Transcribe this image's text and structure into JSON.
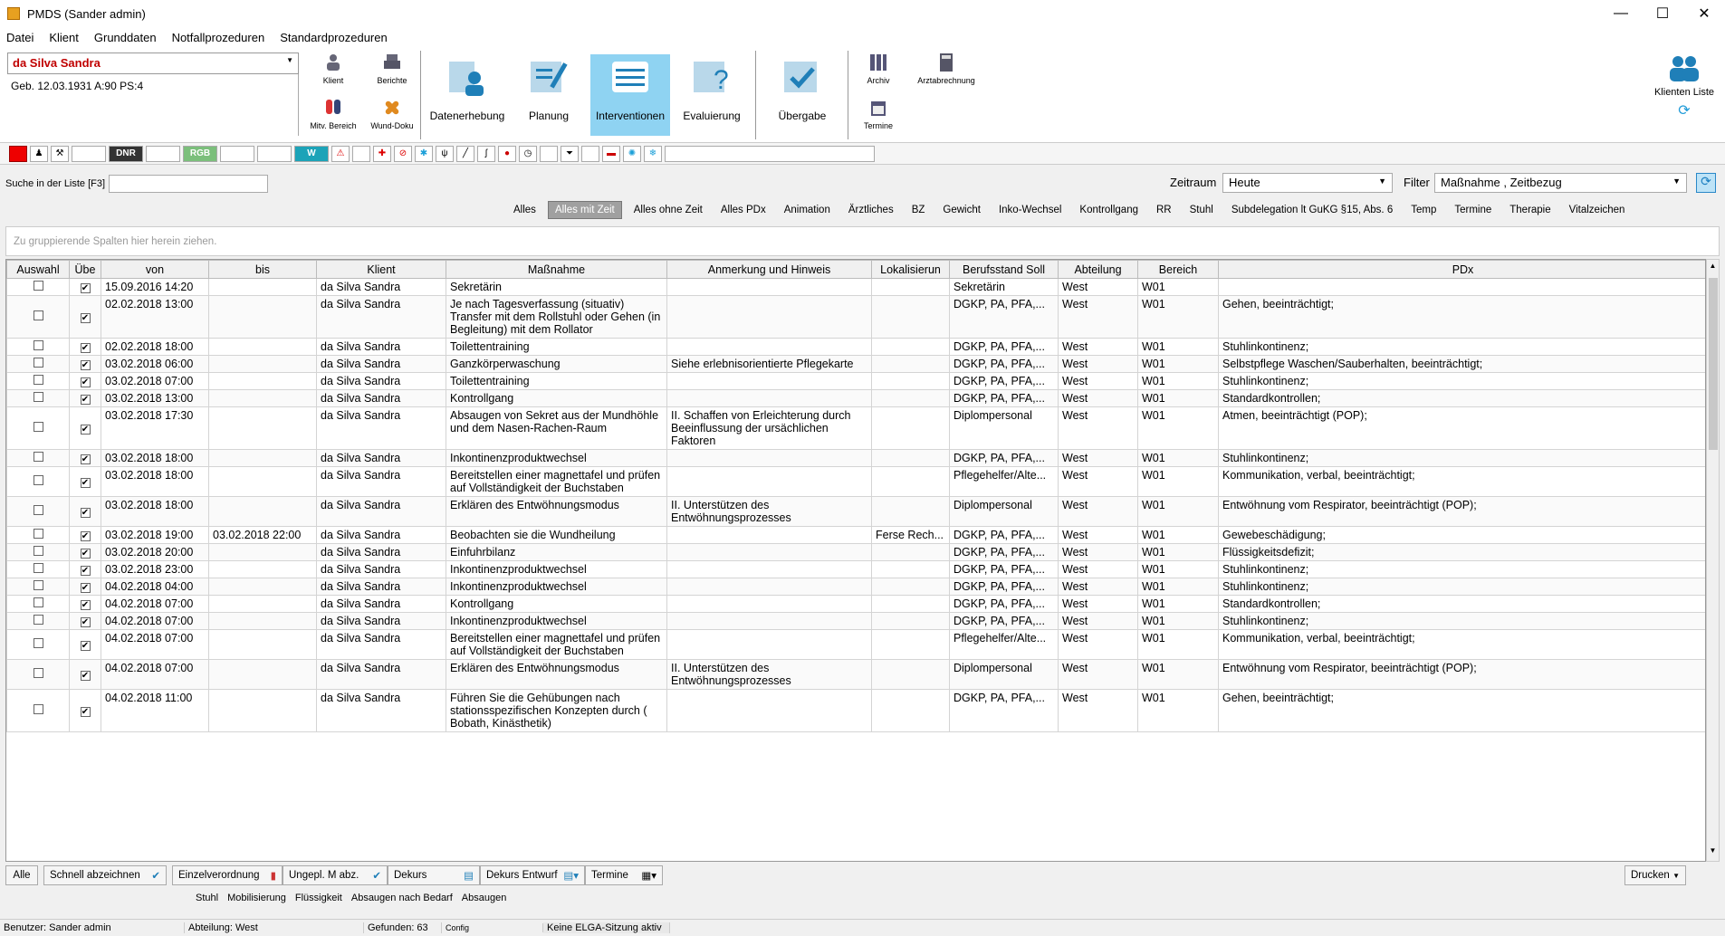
{
  "window": {
    "title": "PMDS (Sander admin)",
    "minimize": "—",
    "maximize": "☐",
    "close": "✕"
  },
  "menu": [
    "Datei",
    "Klient",
    "Grunddaten",
    "Notfallprozeduren",
    "Standardprozeduren"
  ],
  "patient": {
    "name": "da Silva Sandra",
    "info": "Geb. 12.03.1931   A:90   PS:4"
  },
  "small_buttons": {
    "klient": "Klient",
    "berichte": "Berichte",
    "mitv": "Mitv. Bereich",
    "wund": "Wund-Doku",
    "archiv": "Archiv",
    "arztabrechnung": "Arztabrechnung",
    "termine": "Termine"
  },
  "big_buttons": [
    {
      "label": "Datenerhebung"
    },
    {
      "label": "Planung"
    },
    {
      "label": "Interventionen"
    },
    {
      "label": "Evaluierung"
    },
    {
      "label": "Übergabe"
    }
  ],
  "klienten_liste": "Klienten Liste",
  "iconbar": {
    "dnr": "DNR",
    "rgb": "RGB",
    "w": "W"
  },
  "search": {
    "label": "Suche in der Liste [F3]",
    "value": ""
  },
  "zeitraum": {
    "label": "Zeitraum",
    "value": "Heute"
  },
  "filter": {
    "label": "Filter",
    "value": "Maßnahme , Zeitbezug"
  },
  "filter_tabs": [
    "Alles",
    "Alles mit Zeit",
    "Alles ohne Zeit",
    "Alles PDx",
    "Animation",
    "Ärztliches",
    "BZ",
    "Gewicht",
    "Inko-Wechsel",
    "Kontrollgang",
    "RR",
    "Stuhl",
    "Subdelegation lt GuKG §15, Abs. 6",
    "Temp",
    "Termine",
    "Therapie",
    "Vitalzeichen"
  ],
  "group_hint": "Zu gruppierende Spalten hier herein ziehen.",
  "columns": [
    "Auswahl",
    "Übe",
    "von",
    "bis",
    "Klient",
    "Maßnahme",
    "Anmerkung und Hinweis",
    "Lokalisierun",
    "Berufsstand Soll",
    "Abteilung",
    "Bereich",
    "PDx"
  ],
  "rows": [
    {
      "von": "15.09.2016 14:20",
      "bis": "",
      "klient": "da Silva Sandra",
      "massnahme": "Sekretärin",
      "anmerkung": "",
      "lok": "",
      "beruf": "Sekretärin",
      "abt": "West",
      "bereich": "W01",
      "pdx": ""
    },
    {
      "von": "02.02.2018 13:00",
      "bis": "",
      "klient": "da Silva Sandra",
      "massnahme": "Je nach Tagesverfassung (situativ) Transfer mit dem Rollstuhl oder Gehen (in Begleitung) mit dem Rollator",
      "anmerkung": "",
      "lok": "",
      "beruf": "DGKP, PA, PFA,...",
      "abt": "West",
      "bereich": "W01",
      "pdx": "Gehen, beeinträchtigt;"
    },
    {
      "von": "02.02.2018 18:00",
      "bis": "",
      "klient": "da Silva Sandra",
      "massnahme": "Toilettentraining",
      "anmerkung": "",
      "lok": "",
      "beruf": "DGKP, PA, PFA,...",
      "abt": "West",
      "bereich": "W01",
      "pdx": "Stuhlinkontinenz;"
    },
    {
      "von": "03.02.2018 06:00",
      "bis": "",
      "klient": "da Silva Sandra",
      "massnahme": "Ganzkörperwaschung",
      "anmerkung": " Siehe erlebnisorientierte Pflegekarte",
      "lok": "",
      "beruf": "DGKP, PA, PFA,...",
      "abt": "West",
      "bereich": "W01",
      "pdx": "Selbstpflege Waschen/Sauberhalten, beeinträchtigt;"
    },
    {
      "von": "03.02.2018 07:00",
      "bis": "",
      "klient": "da Silva Sandra",
      "massnahme": "Toilettentraining",
      "anmerkung": "",
      "lok": "",
      "beruf": "DGKP, PA, PFA,...",
      "abt": "West",
      "bereich": "W01",
      "pdx": "Stuhlinkontinenz;"
    },
    {
      "von": "03.02.2018 13:00",
      "bis": "",
      "klient": "da Silva Sandra",
      "massnahme": "Kontrollgang",
      "anmerkung": "",
      "lok": "",
      "beruf": "DGKP, PA, PFA,...",
      "abt": "West",
      "bereich": "W01",
      "pdx": "Standardkontrollen;"
    },
    {
      "von": "03.02.2018 17:30",
      "bis": "",
      "klient": "da Silva Sandra",
      "massnahme": "Absaugen von Sekret aus der Mundhöhle und dem Nasen-Rachen-Raum",
      "anmerkung": " II. Schaffen von Erleichterung durch Beeinflussung der ursächlichen Faktoren",
      "lok": "",
      "beruf": "Diplompersonal",
      "abt": "West",
      "bereich": "W01",
      "pdx": "Atmen, beeinträchtigt (POP);"
    },
    {
      "von": "03.02.2018 18:00",
      "bis": "",
      "klient": "da Silva Sandra",
      "massnahme": "Inkontinenzproduktwechsel",
      "anmerkung": "",
      "lok": "",
      "beruf": "DGKP, PA, PFA,...",
      "abt": "West",
      "bereich": "W01",
      "pdx": "Stuhlinkontinenz;"
    },
    {
      "von": "03.02.2018 18:00",
      "bis": "",
      "klient": "da Silva Sandra",
      "massnahme": "Bereitstellen einer magnettafel und prüfen auf Vollständigkeit der Buchstaben",
      "anmerkung": "",
      "lok": "",
      "beruf": "Pflegehelfer/Alte...",
      "abt": "West",
      "bereich": "W01",
      "pdx": "Kommunikation, verbal, beeinträchtigt;"
    },
    {
      "von": "03.02.2018 18:00",
      "bis": "",
      "klient": "da Silva Sandra",
      "massnahme": "Erklären des Entwöhnungsmodus",
      "anmerkung": " II. Unterstützen des Entwöhnungsprozesses",
      "lok": "",
      "beruf": "Diplompersonal",
      "abt": "West",
      "bereich": "W01",
      "pdx": "Entwöhnung vom Respirator, beeinträchtigt (POP);"
    },
    {
      "von": "03.02.2018 19:00",
      "bis": "03.02.2018 22:00",
      "klient": "da Silva Sandra",
      "massnahme": "Beobachten sie die Wundheilung",
      "anmerkung": "",
      "lok": "Ferse  Rech...",
      "beruf": "DGKP, PA, PFA,...",
      "abt": "West",
      "bereich": "W01",
      "pdx": "Gewebeschädigung;"
    },
    {
      "von": "03.02.2018 20:00",
      "bis": "",
      "klient": "da Silva Sandra",
      "massnahme": "Einfuhrbilanz",
      "anmerkung": "",
      "lok": "",
      "beruf": "DGKP, PA, PFA,...",
      "abt": "West",
      "bereich": "W01",
      "pdx": "Flüssigkeitsdefizit;"
    },
    {
      "von": "03.02.2018 23:00",
      "bis": "",
      "klient": "da Silva Sandra",
      "massnahme": "Inkontinenzproduktwechsel",
      "anmerkung": "",
      "lok": "",
      "beruf": "DGKP, PA, PFA,...",
      "abt": "West",
      "bereich": "W01",
      "pdx": "Stuhlinkontinenz;"
    },
    {
      "von": "04.02.2018 04:00",
      "bis": "",
      "klient": "da Silva Sandra",
      "massnahme": "Inkontinenzproduktwechsel",
      "anmerkung": "",
      "lok": "",
      "beruf": "DGKP, PA, PFA,...",
      "abt": "West",
      "bereich": "W01",
      "pdx": "Stuhlinkontinenz;"
    },
    {
      "von": "04.02.2018 07:00",
      "bis": "",
      "klient": "da Silva Sandra",
      "massnahme": "Kontrollgang",
      "anmerkung": "",
      "lok": "",
      "beruf": "DGKP, PA, PFA,...",
      "abt": "West",
      "bereich": "W01",
      "pdx": "Standardkontrollen;"
    },
    {
      "von": "04.02.2018 07:00",
      "bis": "",
      "klient": "da Silva Sandra",
      "massnahme": "Inkontinenzproduktwechsel",
      "anmerkung": "",
      "lok": "",
      "beruf": "DGKP, PA, PFA,...",
      "abt": "West",
      "bereich": "W01",
      "pdx": "Stuhlinkontinenz;"
    },
    {
      "von": "04.02.2018 07:00",
      "bis": "",
      "klient": "da Silva Sandra",
      "massnahme": "Bereitstellen einer magnettafel und prüfen auf Vollständigkeit der Buchstaben",
      "anmerkung": "",
      "lok": "",
      "beruf": "Pflegehelfer/Alte...",
      "abt": "West",
      "bereich": "W01",
      "pdx": "Kommunikation, verbal, beeinträchtigt;"
    },
    {
      "von": "04.02.2018 07:00",
      "bis": "",
      "klient": "da Silva Sandra",
      "massnahme": "Erklären des Entwöhnungsmodus",
      "anmerkung": " II. Unterstützen des Entwöhnungsprozesses",
      "lok": "",
      "beruf": "Diplompersonal",
      "abt": "West",
      "bereich": "W01",
      "pdx": "Entwöhnung vom Respirator, beeinträchtigt (POP);"
    },
    {
      "von": "04.02.2018 11:00",
      "bis": "",
      "klient": "da Silva Sandra",
      "massnahme": "Führen Sie die Gehübungen nach stationsspezifischen Konzepten durch ( Bobath, Kinästhetik)",
      "anmerkung": "",
      "lok": "",
      "beruf": "DGKP, PA, PFA,...",
      "abt": "West",
      "bereich": "W01",
      "pdx": "Gehen, beeinträchtigt;"
    }
  ],
  "bottom_buttons": [
    "Alle",
    "Schnell abzeichnen",
    "Einzelverordnung",
    "Ungepl. M abz.",
    "Dekurs",
    "Dekurs Entwurf",
    "Termine"
  ],
  "drucken": "Drucken",
  "quicklinks": [
    "Stuhl",
    "Mobilisierung",
    "Flüssigkeit",
    "Absaugen nach Bedarf",
    "Absaugen"
  ],
  "status": {
    "benutzer": "Benutzer: Sander admin",
    "abteilung": "Abteilung: West",
    "gefunden": "Gefunden: 63",
    "config": "Config",
    "elga": "Keine ELGA-Sitzung aktiv"
  }
}
